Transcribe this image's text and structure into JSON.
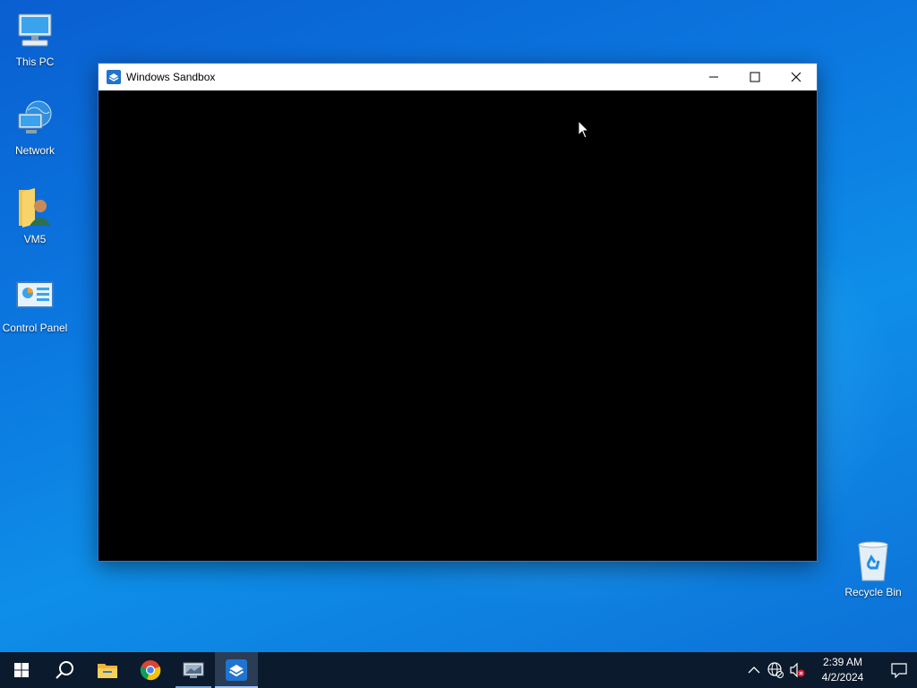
{
  "desktop": {
    "icons": [
      {
        "label": "This PC",
        "icon": "computer-icon"
      },
      {
        "label": "Network",
        "icon": "network-icon"
      },
      {
        "label": "VM5",
        "icon": "user-folder-icon"
      },
      {
        "label": "Control Panel",
        "icon": "control-panel-icon"
      },
      {
        "label": "Recycle Bin",
        "icon": "recycle-bin-icon"
      }
    ]
  },
  "window": {
    "title": "Windows Sandbox",
    "icon": "sandbox-icon",
    "controls": {
      "minimize": "minimize-icon",
      "maximize": "maximize-icon",
      "close": "close-icon"
    }
  },
  "taskbar": {
    "start": "windows-logo-icon",
    "search": "search-icon",
    "pinned": [
      {
        "name": "File Explorer",
        "icon": "folder-icon",
        "running": false
      },
      {
        "name": "Google Chrome",
        "icon": "chrome-icon",
        "running": false
      },
      {
        "name": "Remote Desktop",
        "icon": "remote-desktop-icon",
        "running": true
      },
      {
        "name": "Windows Sandbox",
        "icon": "sandbox-icon",
        "running": true,
        "active": true
      }
    ],
    "tray": {
      "time": "2:39 AM",
      "date": "4/2/2024",
      "icons": [
        "chevron-up-icon",
        "network-globe-icon",
        "volume-muted-icon"
      ]
    }
  },
  "colors": {
    "accent": "#0078d7",
    "taskbar": "#0b1a2c",
    "window_border": "#3d74c7"
  }
}
